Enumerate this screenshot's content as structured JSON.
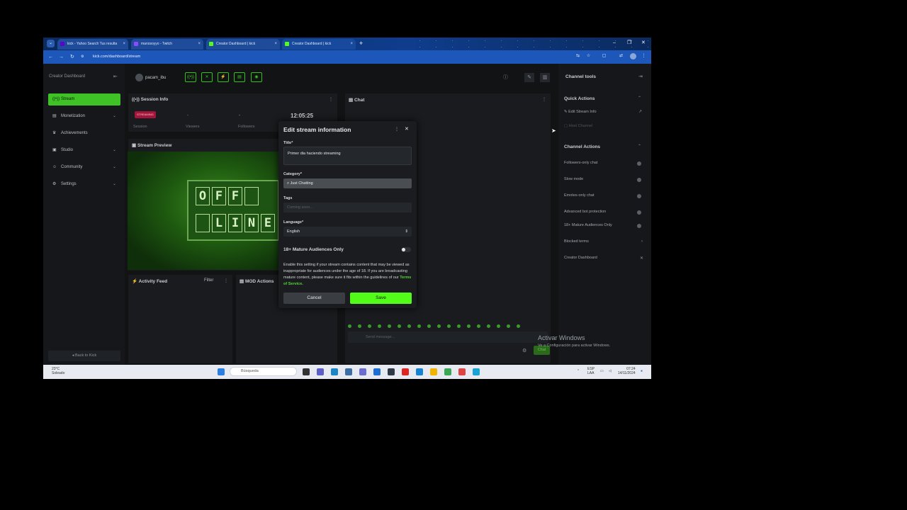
{
  "browser": {
    "tabs": [
      {
        "label": "kick - Yahoo Search Tus resulta",
        "icon_color": "#6001d2"
      },
      {
        "label": "manosoyyo - Twitch",
        "icon_color": "#9146ff"
      },
      {
        "label": "Creator Dashboard | kick",
        "icon_color": "#53fc18"
      },
      {
        "label": "Creator Dashboard | kick",
        "icon_color": "#53fc18"
      }
    ],
    "url": "kick.com/dashboard/stream",
    "new_tab": "+",
    "close_glyph": "×"
  },
  "sidebar": {
    "heading": "Creator Dashboard",
    "items": [
      {
        "label": "Stream",
        "icon": "stream-icon"
      },
      {
        "label": "Monetization",
        "icon": "monetization-icon"
      },
      {
        "label": "Achievements",
        "icon": "trophy-icon"
      },
      {
        "label": "Studio",
        "icon": "studio-icon"
      },
      {
        "label": "Community",
        "icon": "community-icon"
      },
      {
        "label": "Settings",
        "icon": "gear-icon"
      }
    ],
    "back_label": "Back to Kick"
  },
  "topbar": {
    "username": "pacam_ibu"
  },
  "session": {
    "title": "Session Info",
    "badge": "STREAMING",
    "stats": [
      {
        "value": "-",
        "label": "Session"
      },
      {
        "value": "-",
        "label": "Viewers"
      },
      {
        "value": "-",
        "label": "Followers"
      }
    ],
    "clock": "12:05:25"
  },
  "preview": {
    "title": "Stream Preview",
    "sign_row1": [
      "O",
      "F",
      "F",
      ""
    ],
    "sign_row2": [
      "",
      "L",
      "I",
      "N",
      "E"
    ]
  },
  "activity": {
    "title": "Activity Feed",
    "filter": "Filter"
  },
  "mod": {
    "title": "MOD Actions"
  },
  "chat": {
    "title": "Chat",
    "placeholder": "Send message...",
    "send": "Chat"
  },
  "modal": {
    "title": "Edit stream information",
    "title_label": "Title*",
    "title_value": "Primer dia haciendo streaming",
    "category_label": "Category*",
    "category_value": "Just Chatting",
    "tags_label": "Tags",
    "tags_placeholder": "Coming soon...",
    "language_label": "Language*",
    "language_value": "English",
    "mature_label": "18+ Mature Audiences Only",
    "mature_desc": "Enable this setting if your stream contains content that may be viewed as inappropriate for audiences under the age of 18. If you are broadcasting mature content, please make sure it fits within the guidelines of our",
    "mature_link": "Terms of Service.",
    "cancel": "Cancel",
    "save": "Save"
  },
  "tools": {
    "title": "Channel tools",
    "quick_actions": "Quick Actions",
    "quick_items": [
      "Edit Stream Info",
      "Host Channel"
    ],
    "channel_actions": "Channel Actions",
    "channel_items": [
      "Followers-only chat",
      "Slow mode",
      "Emotes-only chat",
      "Advanced bot protection",
      "18+ Mature Audiences Only"
    ],
    "blocked_terms": "Blocked terms",
    "creator_dashboard": "Creator Dashboard"
  },
  "windows": {
    "activate_title": "Activar Windows",
    "activate_sub": "Ve a Configuración para activar Windows.",
    "weather_temp": "23°C",
    "weather_desc": "Soleado",
    "search": "Búsqueda",
    "lang": "ESP",
    "lang2": "LAA",
    "time": "07:24",
    "date": "14/11/2024"
  }
}
